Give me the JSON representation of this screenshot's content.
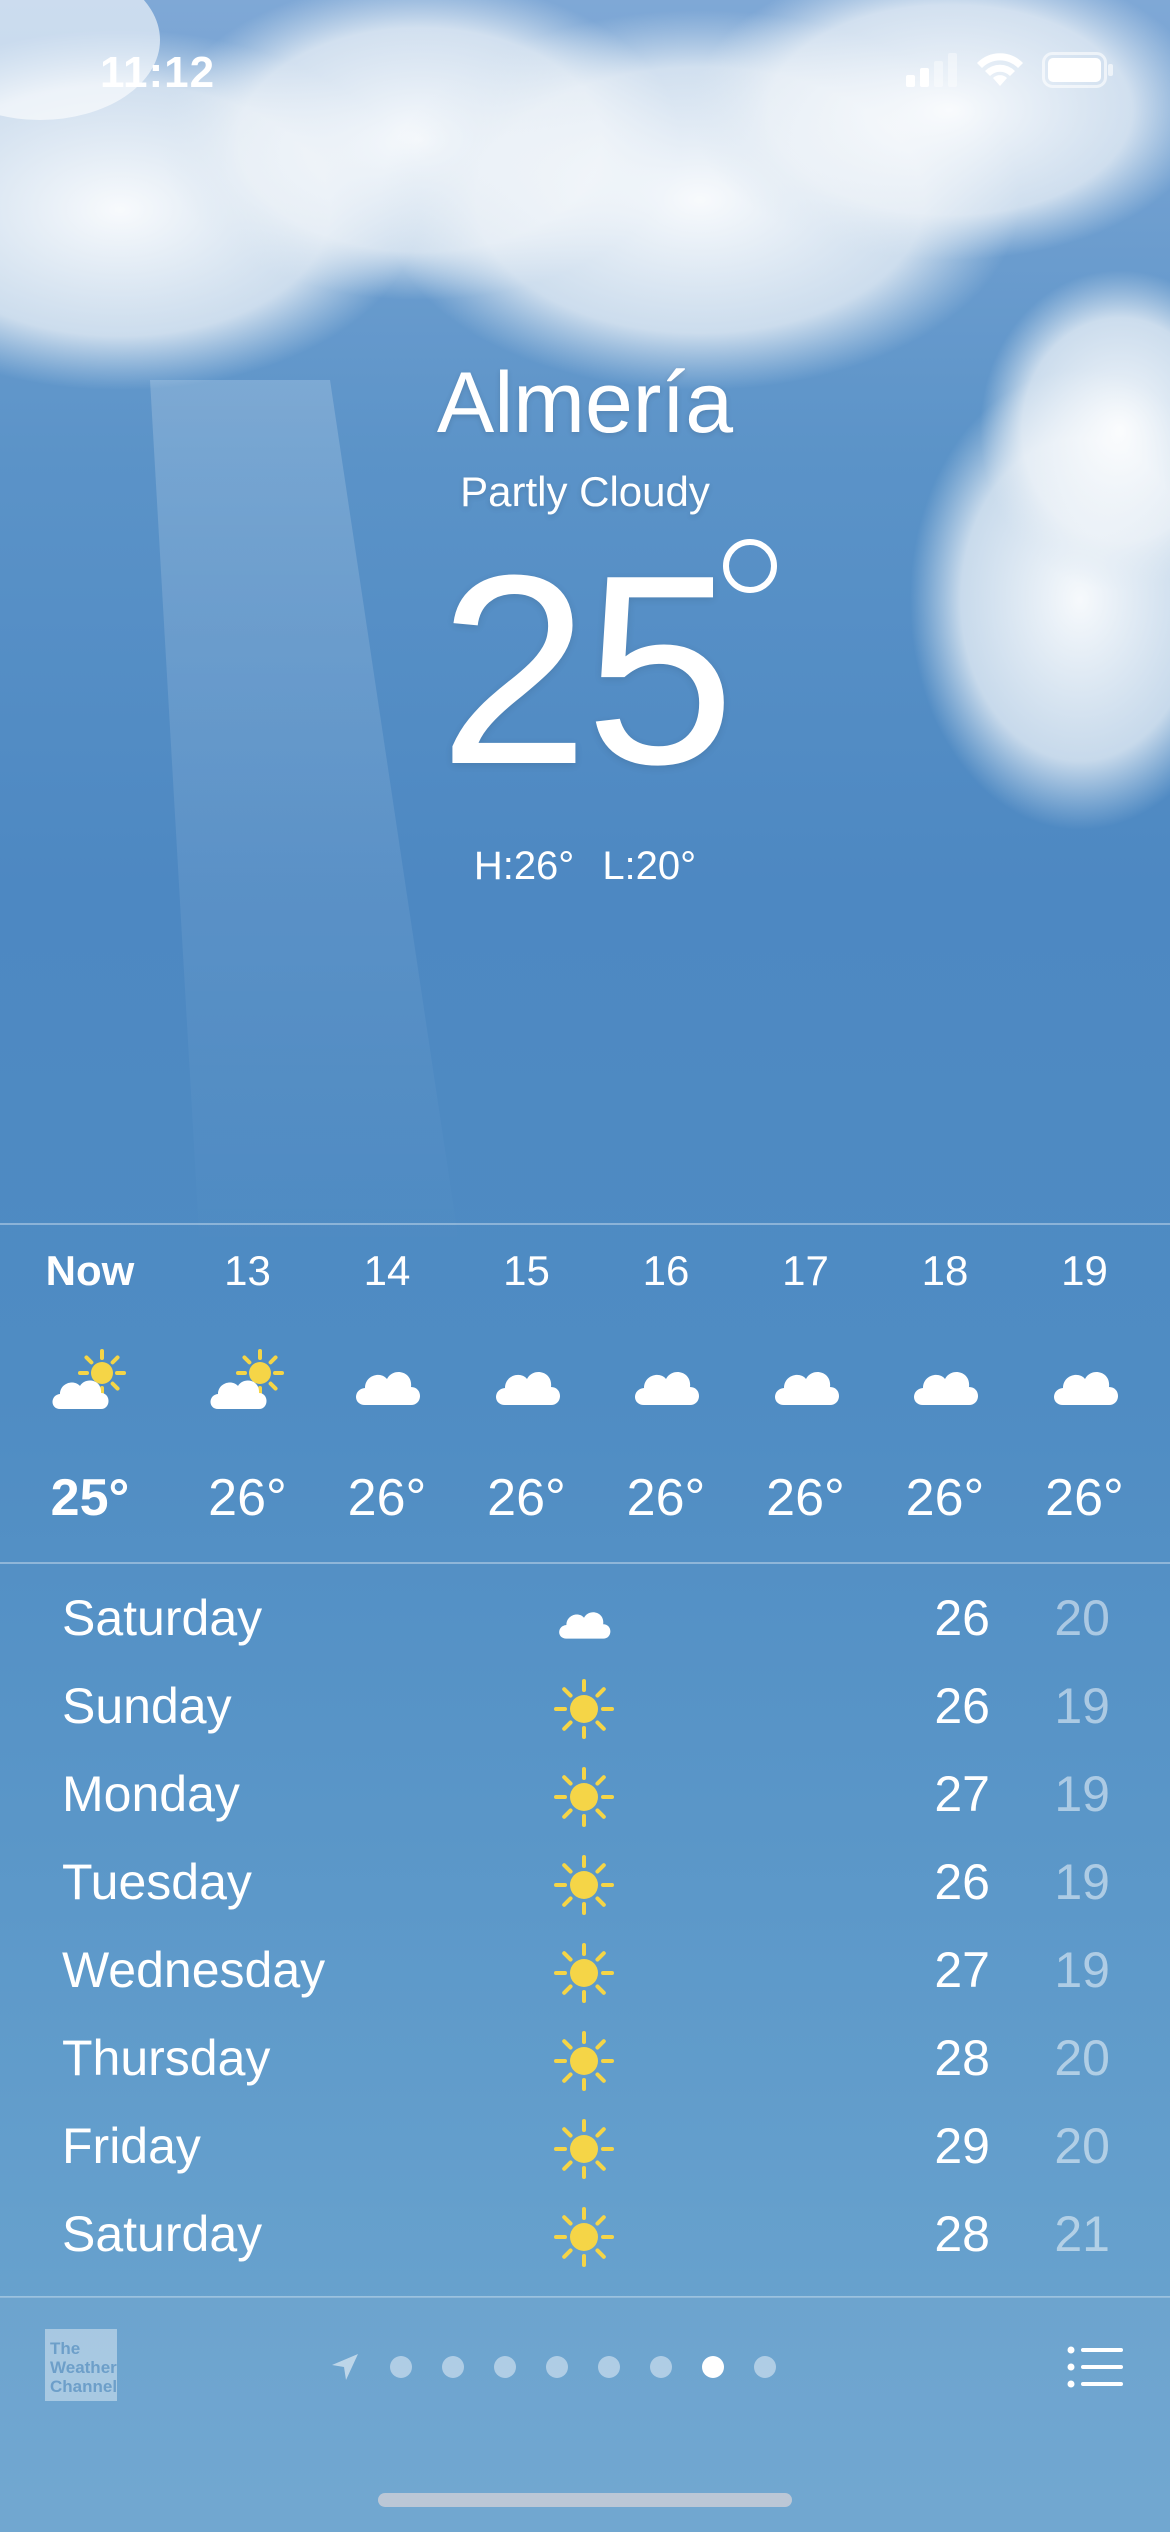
{
  "status_bar": {
    "time": "11:12"
  },
  "location": {
    "city": "Almería",
    "condition": "Partly Cloudy",
    "temperature": "25",
    "high": "H:26°",
    "low": "L:20°"
  },
  "hourly": [
    {
      "label": "Now",
      "icon": "partly-cloudy-icon",
      "temp": "25°"
    },
    {
      "label": "13",
      "icon": "partly-cloudy-icon",
      "temp": "26°"
    },
    {
      "label": "14",
      "icon": "cloud-icon",
      "temp": "26°"
    },
    {
      "label": "15",
      "icon": "cloud-icon",
      "temp": "26°"
    },
    {
      "label": "16",
      "icon": "cloud-icon",
      "temp": "26°"
    },
    {
      "label": "17",
      "icon": "cloud-icon",
      "temp": "26°"
    },
    {
      "label": "18",
      "icon": "cloud-icon",
      "temp": "26°"
    },
    {
      "label": "19",
      "icon": "cloud-icon",
      "temp": "26°"
    }
  ],
  "daily": [
    {
      "day": "Saturday",
      "icon": "cloud-icon",
      "high": "26",
      "low": "20"
    },
    {
      "day": "Sunday",
      "icon": "sun-icon",
      "high": "26",
      "low": "19"
    },
    {
      "day": "Monday",
      "icon": "sun-icon",
      "high": "27",
      "low": "19"
    },
    {
      "day": "Tuesday",
      "icon": "sun-icon",
      "high": "26",
      "low": "19"
    },
    {
      "day": "Wednesday",
      "icon": "sun-icon",
      "high": "27",
      "low": "19"
    },
    {
      "day": "Thursday",
      "icon": "sun-icon",
      "high": "28",
      "low": "20"
    },
    {
      "day": "Friday",
      "icon": "sun-icon",
      "high": "29",
      "low": "20"
    },
    {
      "day": "Saturday",
      "icon": "sun-icon",
      "high": "28",
      "low": "21"
    }
  ],
  "footer": {
    "logo_text": "The Weather Channel",
    "page_count": 8,
    "active_page": 7
  },
  "colors": {
    "sun": "#f5d547",
    "text": "#ffffff",
    "low_temp": "rgba(255,255,255,0.5)"
  }
}
